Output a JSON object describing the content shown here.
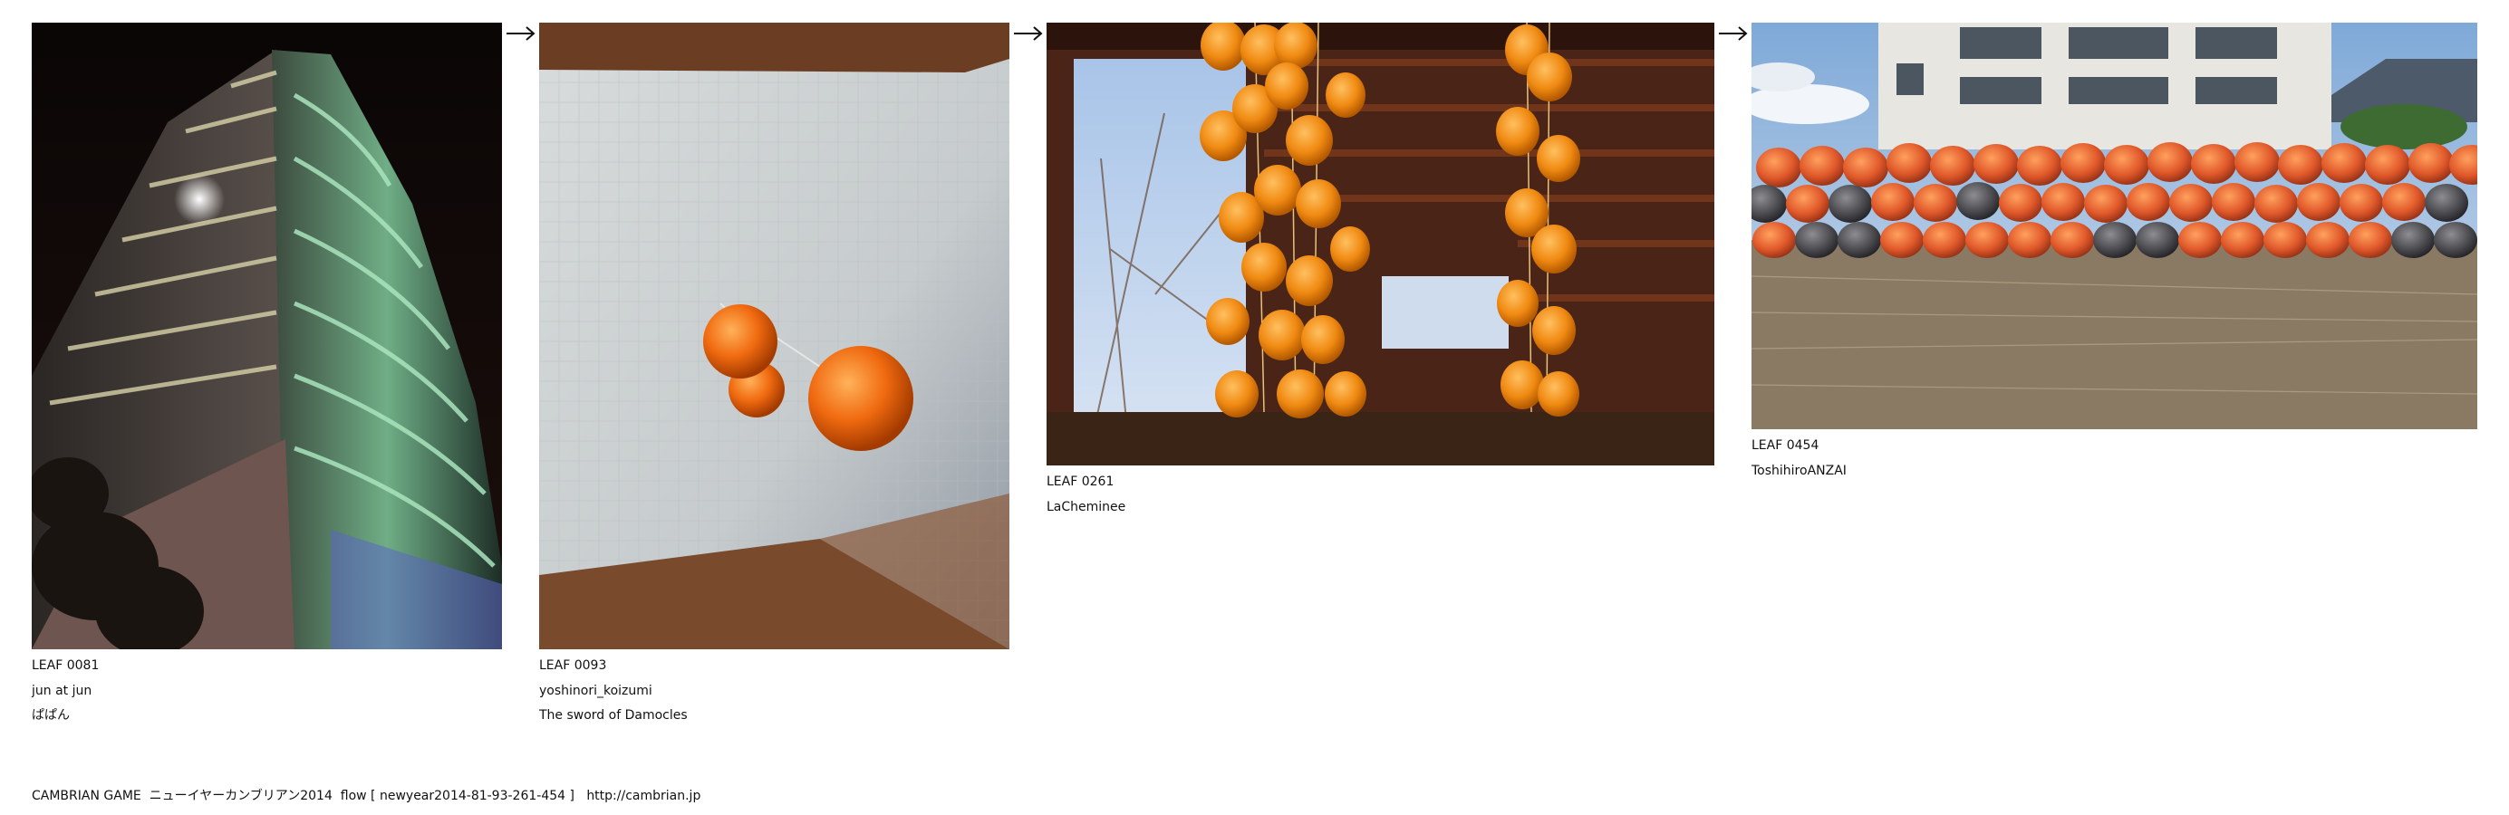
{
  "leaves": [
    {
      "code": "LEAF 0081",
      "author": "jun at jun",
      "title": "ぱぱん",
      "photo_icon": "night-tower-photo"
    },
    {
      "code": "LEAF 0093",
      "author": "yoshinori_koizumi",
      "title": "The sword of Damocles",
      "photo_icon": "hanging-orange-balls-photo"
    },
    {
      "code": "LEAF 0261",
      "author": "LaCheminee",
      "photo_icon": "dried-persimmons-photo"
    },
    {
      "code": "LEAF 0454",
      "author": "ToshihiroANZAI",
      "photo_icon": "buoy-wall-photo"
    }
  ],
  "arrow_glyph": "→",
  "footer": {
    "text": "CAMBRIAN GAME  ニューイヤーカンブリアン2014  flow [ newyear2014-81-93-261-454 ]   ",
    "link": "http://cambrian.jp"
  }
}
